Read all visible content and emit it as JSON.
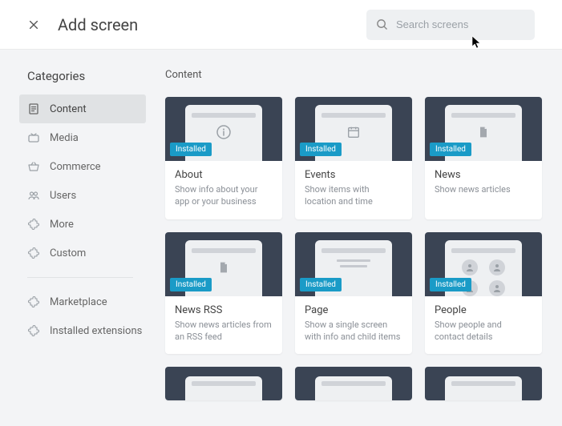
{
  "header": {
    "title": "Add screen",
    "search_placeholder": "Search screens"
  },
  "sidebar": {
    "heading": "Categories",
    "items": [
      {
        "key": "content",
        "label": "Content",
        "icon": "document-icon",
        "active": true
      },
      {
        "key": "media",
        "label": "Media",
        "icon": "tv-icon"
      },
      {
        "key": "commerce",
        "label": "Commerce",
        "icon": "basket-icon"
      },
      {
        "key": "users",
        "label": "Users",
        "icon": "users-icon"
      },
      {
        "key": "more",
        "label": "More",
        "icon": "puzzle-icon"
      },
      {
        "key": "custom",
        "label": "Custom",
        "icon": "puzzle-icon"
      }
    ],
    "footer": [
      {
        "key": "marketplace",
        "label": "Marketplace",
        "icon": "puzzle-icon"
      },
      {
        "key": "installed",
        "label": "Installed extensions",
        "icon": "puzzle-icon"
      }
    ]
  },
  "section": {
    "title": "Content",
    "badge_label": "Installed",
    "cards": [
      {
        "key": "about",
        "title": "About",
        "desc": "Show info about your app or your business",
        "thumb": "info",
        "installed": true
      },
      {
        "key": "events",
        "title": "Events",
        "desc": "Show items with location and time",
        "thumb": "calendar",
        "installed": true
      },
      {
        "key": "news",
        "title": "News",
        "desc": "Show news articles",
        "thumb": "file",
        "installed": true
      },
      {
        "key": "newsrss",
        "title": "News RSS",
        "desc": "Show news articles from an RSS feed",
        "thumb": "file",
        "installed": true
      },
      {
        "key": "page",
        "title": "Page",
        "desc": "Show a single screen with info and child items",
        "thumb": "lines",
        "installed": true
      },
      {
        "key": "people",
        "title": "People",
        "desc": "Show people and contact details",
        "thumb": "avatars",
        "installed": true
      }
    ]
  }
}
